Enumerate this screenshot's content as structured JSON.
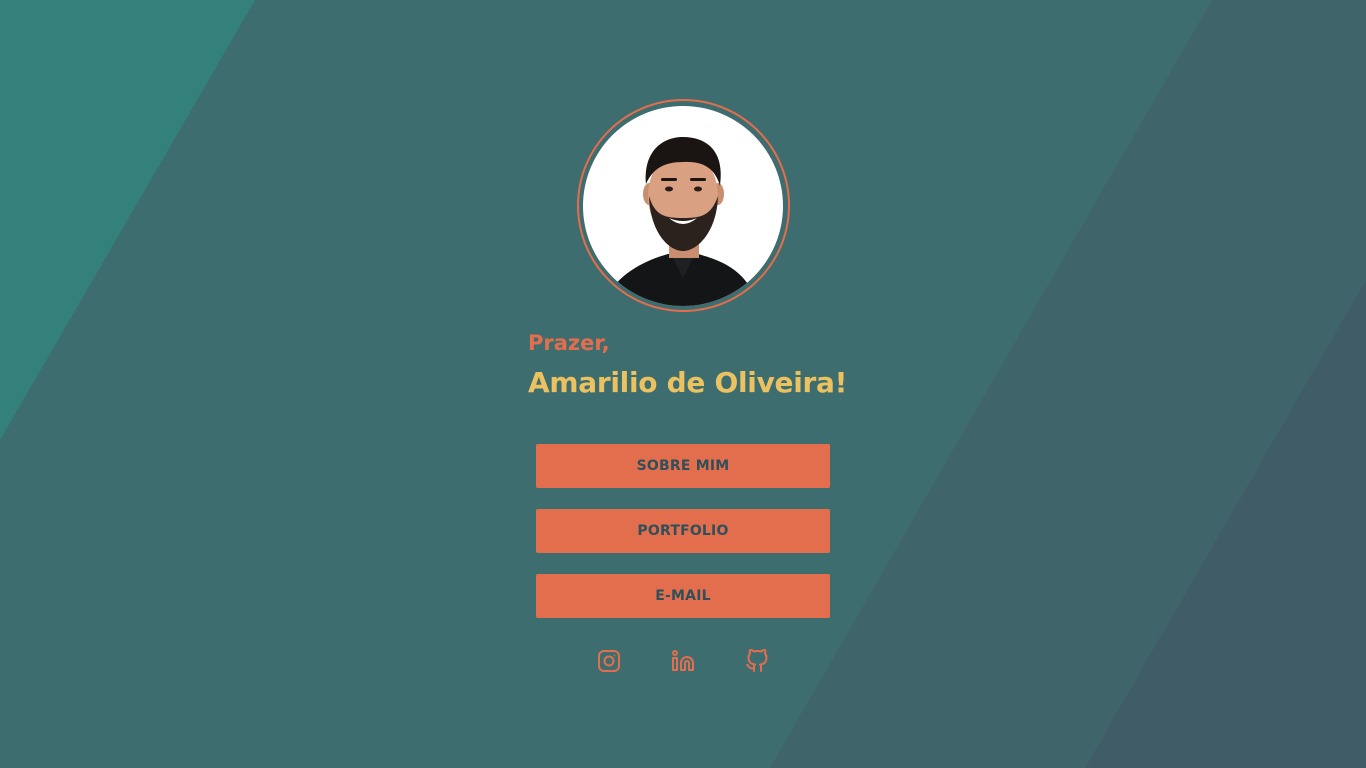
{
  "profile": {
    "greeting": "Prazer,",
    "name": "Amarilio de Oliveira!",
    "photo_alt": "Amarilio de Oliveira"
  },
  "buttons": {
    "about": "SOBRE MIM",
    "portfolio": "PORTFOLIO",
    "email": "E-MAIL"
  },
  "social": [
    {
      "icon": "instagram-icon"
    },
    {
      "icon": "linkedin-icon"
    },
    {
      "icon": "github-icon"
    }
  ],
  "colors": {
    "background": "#3e6d6f",
    "accent": "#e26e4d",
    "name": "#ecc261",
    "button_text": "#2f4f5a"
  }
}
